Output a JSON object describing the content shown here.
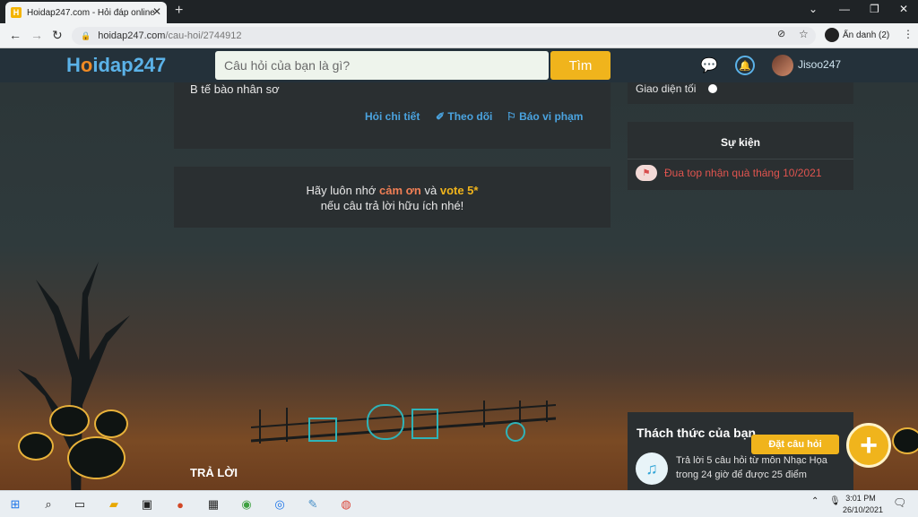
{
  "browser": {
    "tab_title": "Hoidap247.com - Hỏi đáp online",
    "tab_favicon": "H",
    "new_tab_icon": "+",
    "url_host": "hoidap247.com",
    "url_path": "/cau-hoi/2744912",
    "profile_label": "Ẩn danh (2)",
    "window_controls": [
      "minimize-icon",
      "restore-icon",
      "close-icon"
    ]
  },
  "site_header": {
    "logo_text_1": "H",
    "logo_text_2": "o",
    "logo_text_3": "idap247",
    "search_placeholder": "Câu hỏi của bạn là gì?",
    "search_button": "Tìm",
    "username": "Jisoo247",
    "icons": [
      "chat-icon",
      "bell-icon",
      "avatar"
    ]
  },
  "answer": {
    "text": "B tế bào nhân sơ",
    "links": {
      "detail": "Hỏi chi tiết",
      "follow": "✐ Theo dõi",
      "report": "⚐ Báo vi phạm"
    }
  },
  "reminder": {
    "prefix": "Hãy luôn nhớ ",
    "thank": "cảm ơn",
    "middle": " và ",
    "vote": "vote 5*",
    "line2": "nếu câu trả lời hữu ích nhé!"
  },
  "answers_heading": "TRẢ LỜI",
  "sidebar": {
    "dark_mode_label": "Giao diện tối",
    "events_title": "Sự kiện",
    "event_link": "Đua top nhận quà tháng 10/2021",
    "challenge_title": "Thách thức của bạn",
    "challenge_text": "Trả lời 5 câu hỏi  từ môn Nhạc Họa trong 24 giờ để được 25 điểm",
    "ask_label": "Đặt câu hỏi",
    "ask_icon": "+"
  },
  "taskbar": {
    "time": "3:01 PM",
    "date": "26/10/2021"
  },
  "colors": {
    "brand_blue": "#4aa3df",
    "brand_yellow": "#f0b41c",
    "header_bg": "#24313a",
    "card_bg": "#2a2f31",
    "event_red": "#e0544f"
  }
}
